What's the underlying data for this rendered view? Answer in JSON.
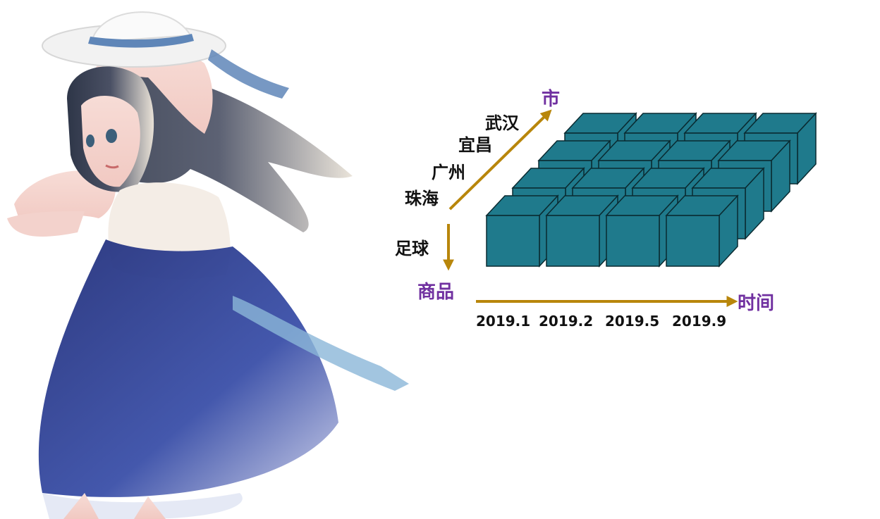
{
  "illustration": {
    "icon": "anime-girl-illustration"
  },
  "axes": {
    "city": {
      "name": "市",
      "color": "#7030A0"
    },
    "product": {
      "name": "商品",
      "color": "#7030A0"
    },
    "time": {
      "name": "时间",
      "color": "#7030A0"
    },
    "arrow_color": "#B8860B"
  },
  "cities": [
    "珠海",
    "广州",
    "宜昌",
    "武汉"
  ],
  "products": [
    "足球"
  ],
  "dates": [
    "2019.1",
    "2019.2",
    "2019.5",
    "2019.9"
  ],
  "cube": {
    "columns": 4,
    "rows": 4,
    "front_color": "#1F7A8C",
    "top_color": "#1F7A8C",
    "side_color": "#1F7A8C",
    "edge_color": "#0a2a30"
  }
}
